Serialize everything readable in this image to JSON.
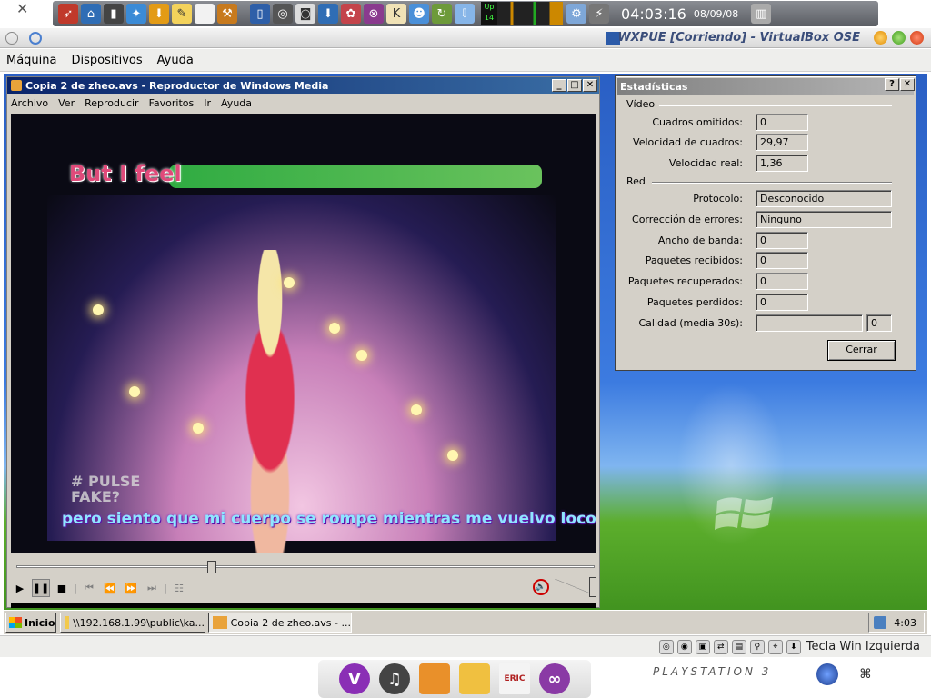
{
  "host_panel": {
    "clock": "04:03:16",
    "date": "08/09/08",
    "netmon_label": "Up 14",
    "launcher_icons": [
      "rocket-icon",
      "home-icon",
      "terminal-icon",
      "sparkle-icon",
      "download-icon",
      "notes-icon",
      "blank-icon",
      "wrench-icon"
    ]
  },
  "vbox": {
    "title": "WXPUE [Corriendo] - VirtualBox OSE",
    "menu": [
      "Máquina",
      "Dispositivos",
      "Ayuda"
    ],
    "host_key_label": "Tecla Win Izquierda"
  },
  "wmp": {
    "title": "Copia 2 de zheo.avs - Reproductor de Windows Media",
    "menu": [
      "Archivo",
      "Ver",
      "Reproducir",
      "Favoritos",
      "Ir",
      "Ayuda"
    ],
    "subtitle_top": "But I feel",
    "subtitle_bottom": "pero siento que mi cuerpo se rompe mientras me vuelvo loco",
    "channel_logo_line1": "# PULSE",
    "channel_logo_line2": "FAKE?",
    "seek_position": 0.33,
    "volume_level": 1.0
  },
  "stats": {
    "title": "Estadísticas",
    "help_label": "?",
    "close_x": "X",
    "video_group": "Vídeo",
    "red_group": "Red",
    "video_rows": [
      {
        "label": "Cuadros omitidos:",
        "value": "0"
      },
      {
        "label": "Velocidad de cuadros:",
        "value": "29,97"
      },
      {
        "label": "Velocidad real:",
        "value": "1,36"
      }
    ],
    "network_rows": [
      {
        "label": "Protocolo:",
        "value": "Desconocido"
      },
      {
        "label": "Corrección de errores:",
        "value": "Ninguno"
      },
      {
        "label": "Ancho de banda:",
        "value": "0"
      },
      {
        "label": "Paquetes recibidos:",
        "value": "0"
      },
      {
        "label": "Paquetes recuperados:",
        "value": "0"
      },
      {
        "label": "Paquetes perdidos:",
        "value": "0"
      }
    ],
    "quality_label": "Calidad (media 30s):",
    "quality_value": "0",
    "close_button": "Cerrar"
  },
  "taskbar": {
    "start_label": "Inicio",
    "tasks": [
      "\\\\192.168.1.99\\public\\ka...",
      "Copia 2 de zheo.avs - ..."
    ],
    "time": "4:03"
  },
  "dock": {
    "ps3_text": "PLAYSTATION 3",
    "apps": [
      "V",
      "♫",
      "",
      "",
      "ERIC",
      "∞"
    ]
  }
}
